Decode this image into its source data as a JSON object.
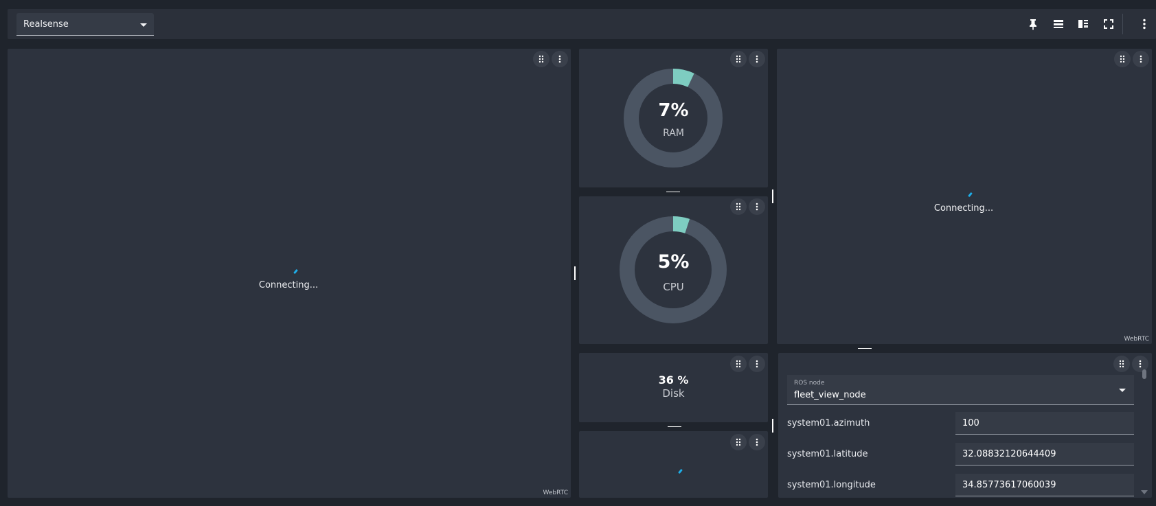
{
  "toolbar": {
    "view_select": "Realsense",
    "icons": [
      "pin-icon",
      "horizontal-layout-icon",
      "sidebar-layout-icon",
      "fullscreen-icon",
      "more-vert-icon"
    ]
  },
  "panels": {
    "left_video": {
      "status": "Connecting...",
      "source": "WebRTC"
    },
    "ram": {
      "value": "7%",
      "label": "RAM",
      "percent": 7,
      "color": "#7ecdc1"
    },
    "cpu": {
      "value": "5%",
      "label": "CPU",
      "percent": 5,
      "color": "#7ecdc1"
    },
    "disk": {
      "value": "36 %",
      "label": "Disk"
    },
    "right_video": {
      "status": "Connecting...",
      "source": "WebRTC"
    },
    "params": {
      "node_label": "ROS node",
      "node_value": "fleet_view_node",
      "rows": [
        {
          "name": "system01.azimuth",
          "value": "100"
        },
        {
          "name": "system01.latitude",
          "value": "32.08832120644409"
        },
        {
          "name": "system01.longitude",
          "value": "34.85773617060039"
        }
      ]
    }
  },
  "colors": {
    "background": "#1f242c",
    "panel": "#2d333e",
    "accent": "#1eaee8",
    "gauge_track": "#4b5563"
  }
}
